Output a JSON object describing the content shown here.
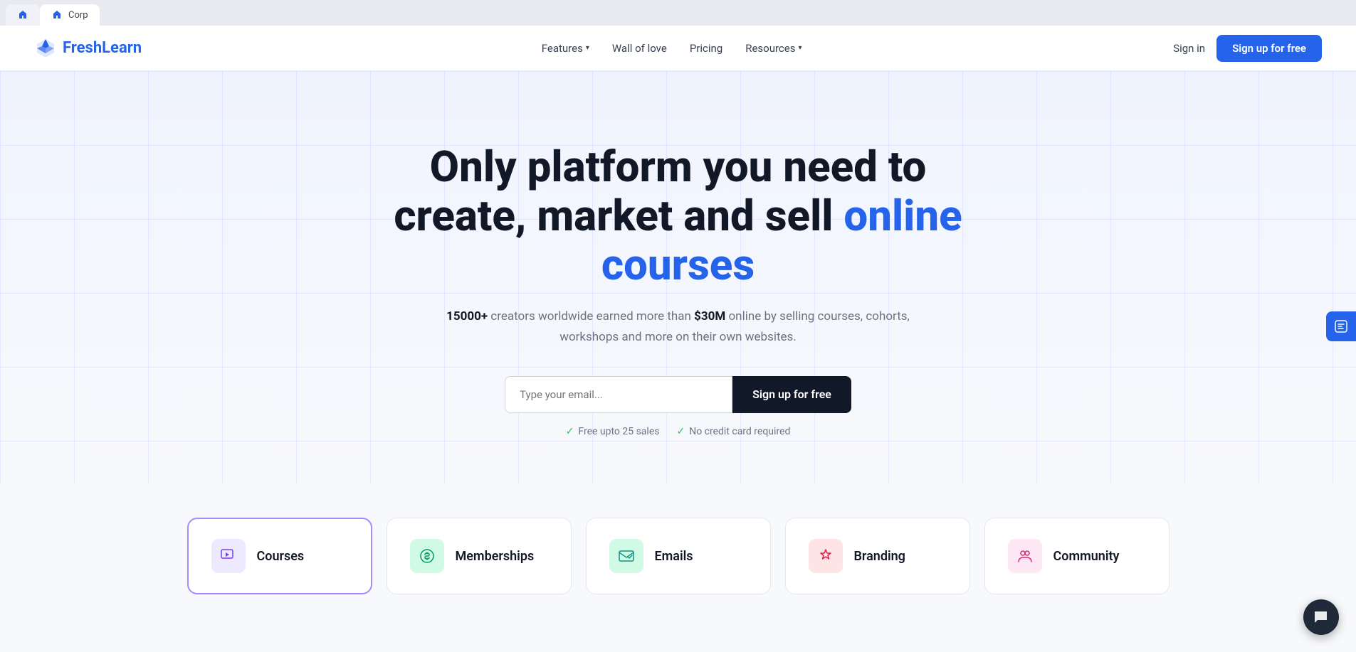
{
  "browser": {
    "tabs": [
      {
        "id": "tab1",
        "label": "",
        "icon": "◆",
        "active": false
      },
      {
        "id": "tab2",
        "label": "Corp",
        "icon": "◆",
        "active": true
      }
    ]
  },
  "navbar": {
    "logo_icon": "◆",
    "logo_text_fresh": "Fresh",
    "logo_text_learn": "Learn",
    "nav_items": [
      {
        "id": "features",
        "label": "Features",
        "has_dropdown": true
      },
      {
        "id": "wall-of-love",
        "label": "Wall of love",
        "has_dropdown": false
      },
      {
        "id": "pricing",
        "label": "Pricing",
        "has_dropdown": false
      },
      {
        "id": "resources",
        "label": "Resources",
        "has_dropdown": true
      }
    ],
    "sign_in": "Sign in",
    "sign_up": "Sign up for free"
  },
  "hero": {
    "title_line1": "Only platform you need to",
    "title_line2": "create, market and sell ",
    "title_accent": "online courses",
    "subtitle_bold1": "15000+",
    "subtitle_text1": " creators worldwide earned more than ",
    "subtitle_bold2": "$30M",
    "subtitle_text2": " online by selling courses, cohorts,",
    "subtitle_line2": "workshops and more on their own websites.",
    "email_placeholder": "Type your email...",
    "cta_button": "Sign up for free",
    "badge1": "Free upto 25 sales",
    "badge2": "No credit card required"
  },
  "features": {
    "cards": [
      {
        "id": "courses",
        "label": "Courses",
        "icon": "🎬",
        "icon_class": "icon-courses",
        "active": true
      },
      {
        "id": "memberships",
        "label": "Memberships",
        "icon": "💲",
        "icon_class": "icon-memberships",
        "active": false
      },
      {
        "id": "emails",
        "label": "Emails",
        "icon": "✉️",
        "icon_class": "icon-emails",
        "active": false
      },
      {
        "id": "branding",
        "label": "Branding",
        "icon": "🔔",
        "icon_class": "icon-branding",
        "active": false
      },
      {
        "id": "community",
        "label": "Community",
        "icon": "👥",
        "icon_class": "icon-community",
        "active": false
      }
    ]
  },
  "icons": {
    "chevron_down": "▾",
    "check": "✓",
    "chat": "💬",
    "lightning": "⚡"
  },
  "colors": {
    "brand_blue": "#2563eb",
    "accent_purple": "#a78bfa",
    "dark": "#111827",
    "green": "#22c55e"
  }
}
